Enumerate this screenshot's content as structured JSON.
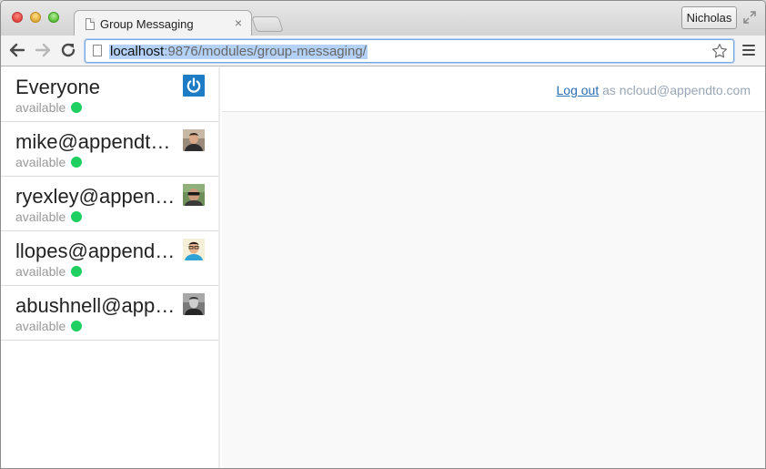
{
  "browser": {
    "tab_title": "Group Messaging",
    "tab_close": "×",
    "profile_name": "Nicholas",
    "url_host": "localhost",
    "url_path": ":9876/modules/group-messaging/"
  },
  "sidebar": {
    "contacts": [
      {
        "name": "Everyone",
        "status": "available",
        "avatar": "power-icon"
      },
      {
        "name": "mike@appendto.com",
        "status": "available",
        "avatar": "photo"
      },
      {
        "name": "ryexley@appendto.com",
        "status": "available",
        "avatar": "photo"
      },
      {
        "name": "llopes@appendto.com",
        "status": "available",
        "avatar": "photo"
      },
      {
        "name": "abushnell@appendto.com",
        "status": "available",
        "avatar": "photo"
      }
    ]
  },
  "header": {
    "logout_label": "Log out",
    "logged_in_as": " as ncloud@appendto.com"
  },
  "colors": {
    "status_available": "#1fd060",
    "link": "#2a6fb5",
    "accent_blue": "#1e7cc5"
  }
}
